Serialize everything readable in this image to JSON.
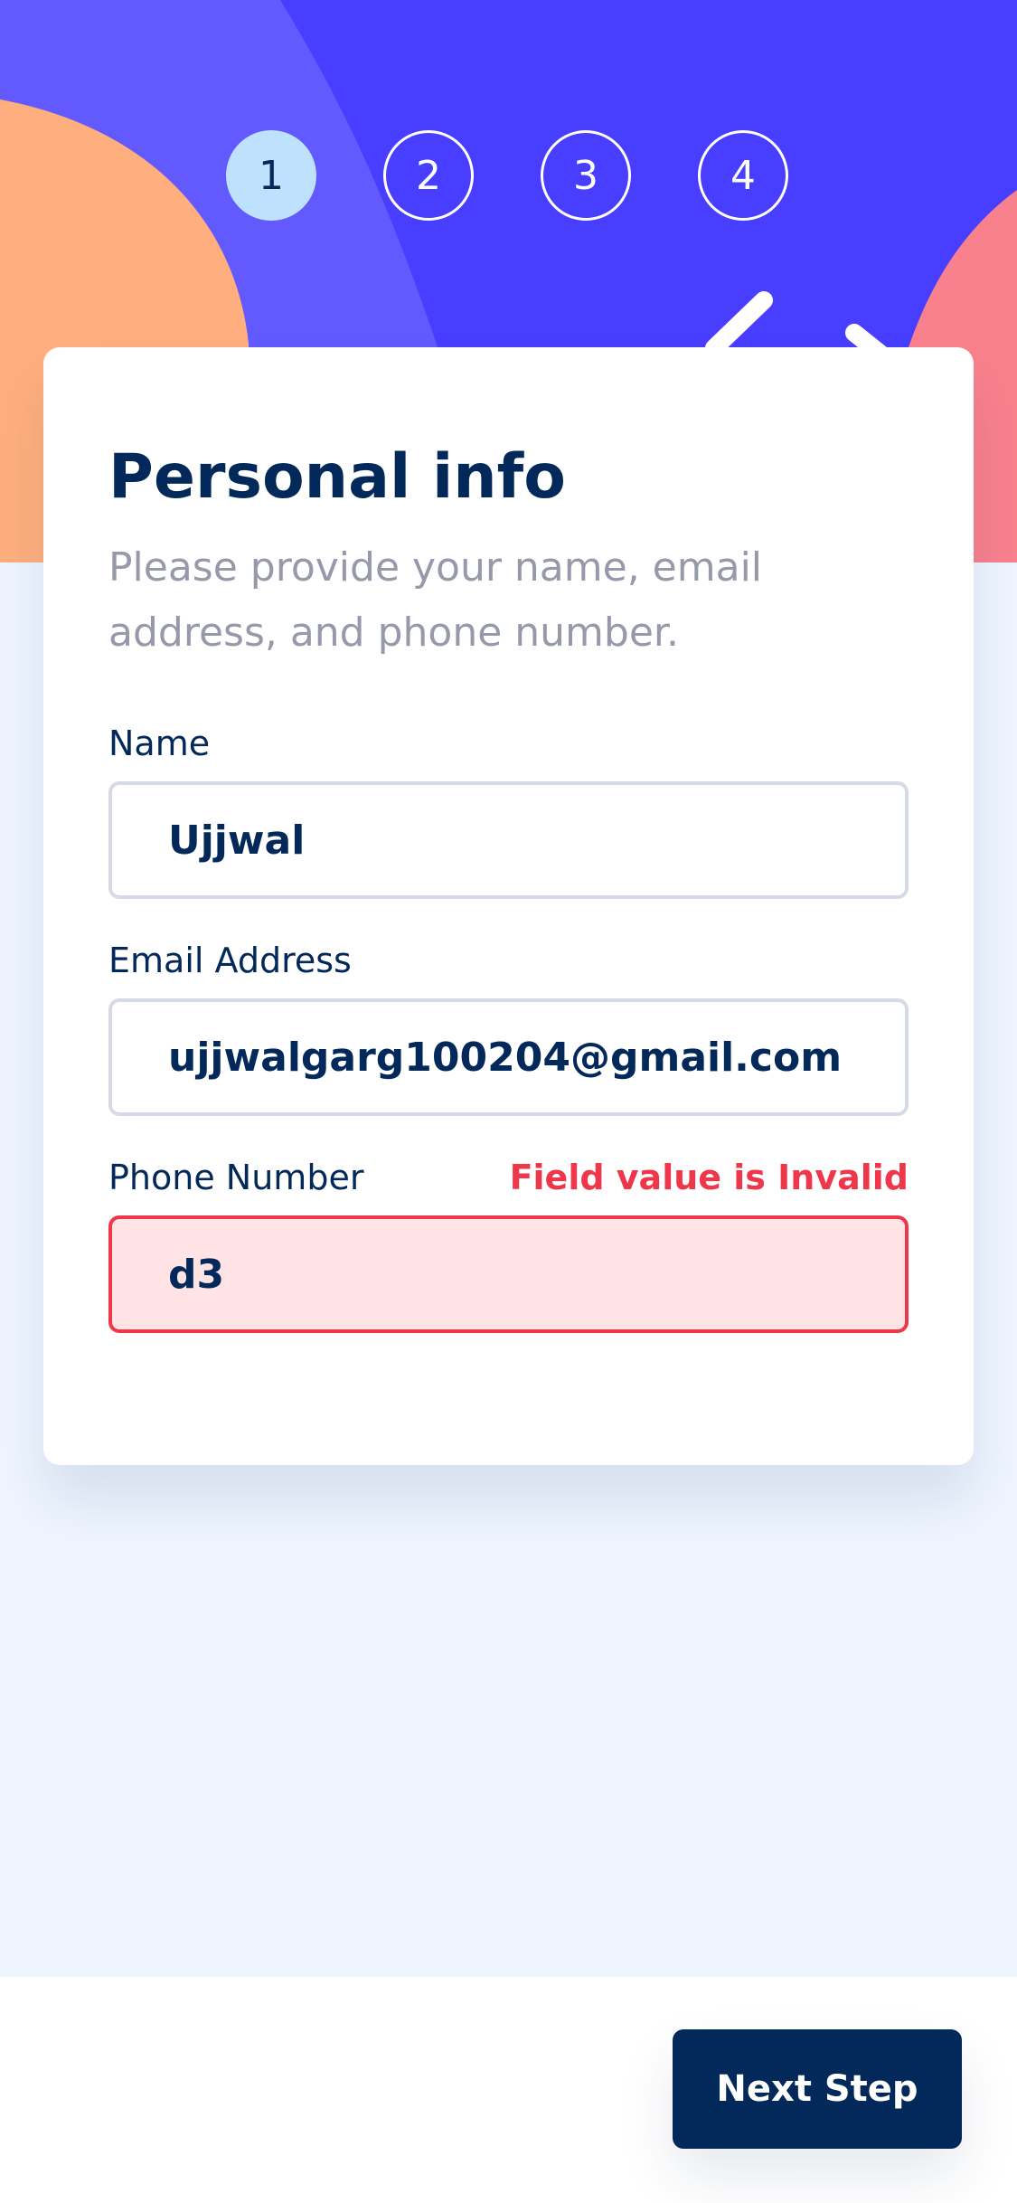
{
  "colors": {
    "primary": "#483eff",
    "dark": "#022959",
    "error": "#ee374a",
    "muted": "#9699aa",
    "active_step": "#bee2fd",
    "background": "#eef5ff"
  },
  "steps": [
    {
      "number": "1",
      "active": true
    },
    {
      "number": "2",
      "active": false
    },
    {
      "number": "3",
      "active": false
    },
    {
      "number": "4",
      "active": false
    }
  ],
  "card": {
    "title": "Personal info",
    "subtitle": "Please provide your name, email address, and phone number."
  },
  "fields": {
    "name": {
      "label": "Name",
      "value": "Ujjwal"
    },
    "email": {
      "label": "Email Address",
      "value": "ujjwalgarg100204@gmail.com"
    },
    "phone": {
      "label": "Phone Number",
      "value": "d3",
      "error": "Field value is Invalid"
    }
  },
  "footer": {
    "next_label": "Next Step"
  }
}
